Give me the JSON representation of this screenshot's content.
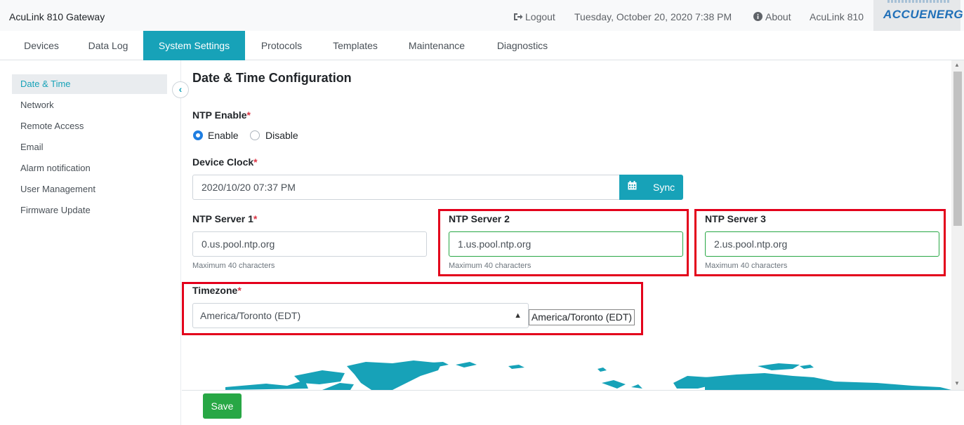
{
  "header": {
    "app_title": "AcuLink 810 Gateway",
    "logout_label": "Logout",
    "datetime": "Tuesday, October 20, 2020 7:38 PM",
    "about_label": "About",
    "device_name": "AcuLink 810",
    "brand": "ACCUENERGY"
  },
  "nav": {
    "tabs": [
      {
        "label": "Devices"
      },
      {
        "label": "Data Log"
      },
      {
        "label": "System Settings"
      },
      {
        "label": "Protocols"
      },
      {
        "label": "Templates"
      },
      {
        "label": "Maintenance"
      },
      {
        "label": "Diagnostics"
      }
    ],
    "active": "System Settings"
  },
  "sidebar": {
    "items": [
      {
        "label": "Date & Time"
      },
      {
        "label": "Network"
      },
      {
        "label": "Remote Access"
      },
      {
        "label": "Email"
      },
      {
        "label": "Alarm notification"
      },
      {
        "label": "User Management"
      },
      {
        "label": "Firmware Update"
      }
    ],
    "active": "Date & Time",
    "collapse_icon": "chevron-left-icon"
  },
  "main": {
    "title": "Date & Time Configuration",
    "ntp_enable": {
      "label": "NTP Enable",
      "required_mark": "*",
      "options": [
        "Enable",
        "Disable"
      ],
      "selected": "Enable"
    },
    "device_clock": {
      "label": "Device Clock",
      "required_mark": "*",
      "value": "2020/10/20 07:37 PM",
      "sync_label": "Sync",
      "sync_icon": "calendar-icon"
    },
    "ntp_servers": [
      {
        "label": "NTP Server 1",
        "required_mark": "*",
        "value": "0.us.pool.ntp.org",
        "hint": "Maximum 40 characters"
      },
      {
        "label": "NTP Server 2",
        "required_mark": "",
        "value": "1.us.pool.ntp.org",
        "hint": "Maximum 40 characters"
      },
      {
        "label": "NTP Server 3",
        "required_mark": "",
        "value": "2.us.pool.ntp.org",
        "hint": "Maximum 40 characters"
      }
    ],
    "timezone": {
      "label": "Timezone",
      "required_mark": "*",
      "selected": "America/Toronto (EDT)",
      "display": "America/Toronto (EDT)"
    }
  },
  "footer": {
    "save_label": "Save"
  },
  "colors": {
    "accent": "#17a2b8",
    "save": "#28a745",
    "highlight": "#e3001b",
    "valid_border": "#28a745"
  }
}
